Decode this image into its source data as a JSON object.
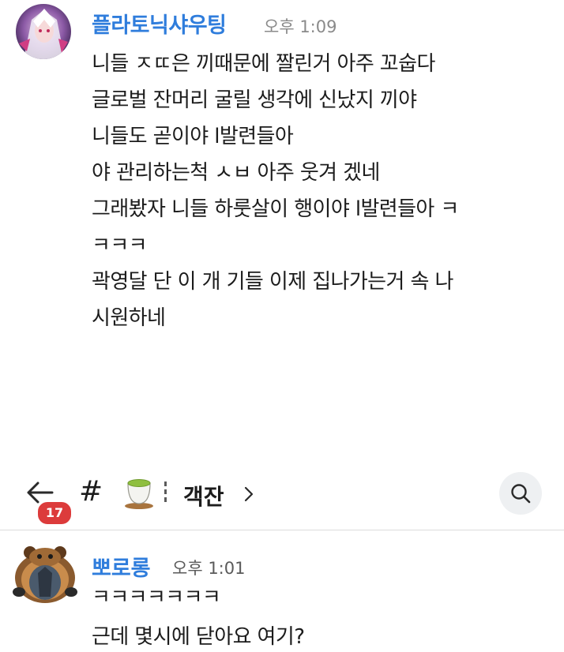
{
  "message_top": {
    "sender": "플라토닉샤우팅",
    "time": "오후 1:09",
    "lines": [
      "니들 ㅈㄸ은 끼때문에 짤린거 아주 꼬숩다",
      "글로벌 잔머리 굴릴 생각에 신났지 끼야",
      "니들도 곧이야 l발련들아",
      "야 관리하는척 ㅅㅂ 아주 웃겨 겠네",
      "그래봤자 니들 하룻살이 행이야 l발련들아 ㅋ",
      "ㅋㅋㅋ",
      "곽영달 단 이 개 기들 이제 집나가는거 속 나",
      "시원하네"
    ]
  },
  "channel_bar": {
    "unread_count": "17",
    "hash_symbol": "#",
    "channel_name": "객잔",
    "icons": {
      "back": "back-arrow-icon",
      "channel": "green-tea-cup-icon",
      "chevron": "chevron-right-icon",
      "search": "search-icon"
    }
  },
  "message_bottom": {
    "sender": "뽀로롱",
    "time": "오후 1:01",
    "lines": [
      "ㅋㅋㅋㅋㅋㅋㅋ",
      "근데 몇시에 닫아요 여기?"
    ]
  },
  "colors": {
    "sender": "#2f7ddc",
    "badge": "#dc3b3b",
    "timestamp": "#8a8a8a",
    "search_bg": "#eef0f2"
  }
}
